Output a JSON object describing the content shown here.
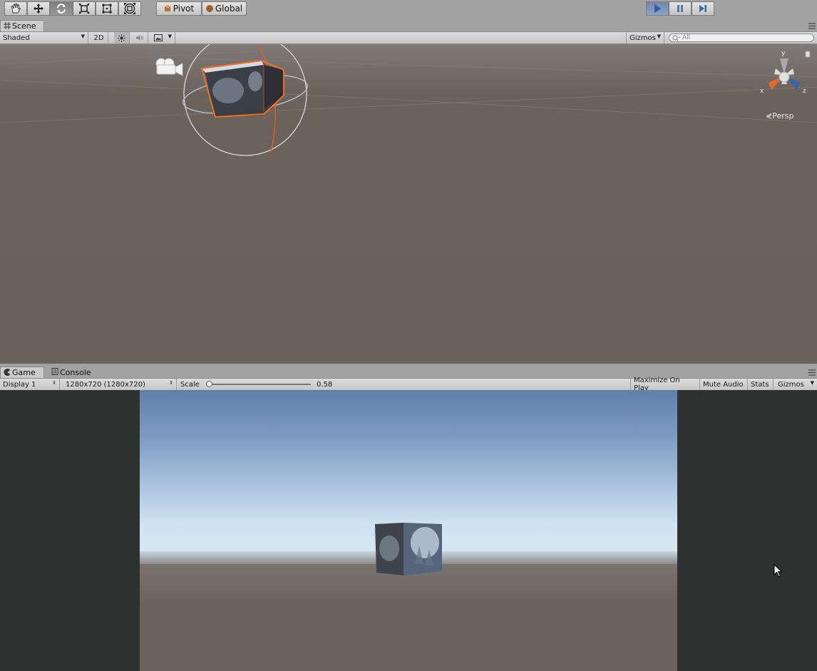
{
  "toolbar": {
    "tools": [
      {
        "name": "hand-tool",
        "icon": "hand-icon"
      },
      {
        "name": "move-tool",
        "icon": "move-arrows-icon"
      },
      {
        "name": "rotate-tool",
        "icon": "rotate-icon",
        "active": true
      },
      {
        "name": "scale-tool",
        "icon": "scale-icon"
      },
      {
        "name": "rect-tool",
        "icon": "rect-icon"
      },
      {
        "name": "transform-tool",
        "icon": "transform-icon"
      }
    ],
    "pivot_label": "Pivot",
    "global_label": "Global",
    "playback": {
      "play_icon": "play-icon",
      "pause_icon": "pause-icon",
      "step_icon": "step-icon",
      "playing": true
    }
  },
  "scene": {
    "tab_label": "Scene",
    "shading_mode": "Shaded",
    "mode_2d_label": "2D",
    "gizmos_label": "Gizmos",
    "search_placeholder": "All",
    "gizmo_axes": {
      "x": "x",
      "y": "y",
      "z": "z"
    },
    "projection_label": "Persp"
  },
  "game": {
    "tab_label": "Game",
    "console_tab_label": "Console",
    "display": "Display 1",
    "resolution": "1280x720 (1280x720)",
    "scale_label": "Scale",
    "scale_value": "0.58",
    "scale_fraction": 0.02,
    "maximize_label": "Maximize On Play",
    "mute_label": "Mute Audio",
    "stats_label": "Stats",
    "gizmos_label": "Gizmos"
  },
  "colors": {
    "accent_play": "#7d97bd",
    "selection_outline": "#f07020",
    "scene_bg": "#6b615b",
    "game_side_bg": "#2f3030"
  }
}
